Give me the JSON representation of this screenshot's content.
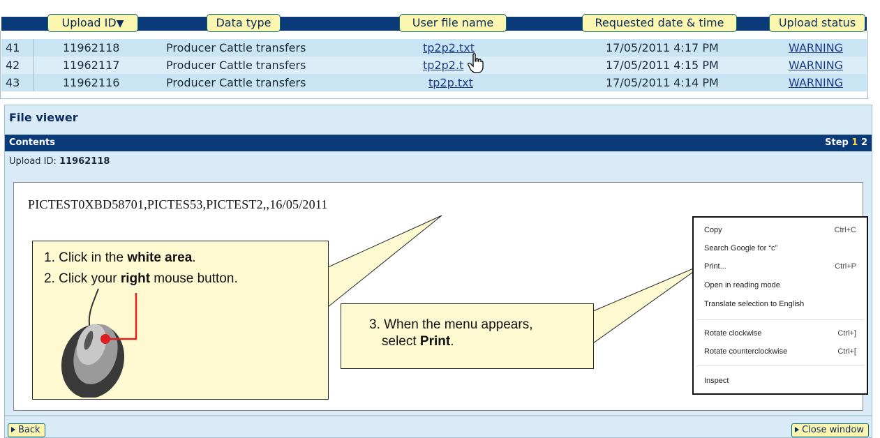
{
  "table": {
    "columns": [
      {
        "label": "Upload ID",
        "sort_icon": "▼"
      },
      {
        "label": "Data type"
      },
      {
        "label": "User file name"
      },
      {
        "label": "Requested date & time"
      },
      {
        "label": "Upload status"
      }
    ],
    "rows": [
      {
        "num": "41",
        "id": "11962118",
        "type": "Producer Cattle transfers",
        "file": "tp2p2.txt",
        "date": "17/05/2011 4:17 PM",
        "status": "WARNING"
      },
      {
        "num": "42",
        "id": "11962117",
        "type": "Producer Cattle transfers",
        "file": "tp2p2.t",
        "date": "17/05/2011 4:15 PM",
        "status": "WARNING"
      },
      {
        "num": "43",
        "id": "11962116",
        "type": "Producer Cattle transfers",
        "file": "tp2p.txt",
        "date": "17/05/2011 4:14 PM",
        "status": "WARNING"
      }
    ]
  },
  "viewer": {
    "title": "File viewer",
    "contents_label": "Contents",
    "step_label": "Step",
    "step_current": "1",
    "step_next": "2",
    "upload_id_label": "Upload ID:",
    "upload_id_value": "11962118",
    "file_text": "PICTEST0XBD58701,PICTES53,PICTEST2,,16/05/2011",
    "back_label": "Back",
    "close_label": "Close window"
  },
  "callouts": {
    "left_line1_pre": "1. Click in the ",
    "left_line1_bold": "white area",
    "left_line1_post": ".",
    "left_line2_pre": "2. Click your ",
    "left_line2_bold": "right",
    "left_line2_post": " mouse button.",
    "right_line1": "3. When the menu appears,",
    "right_line2_pre": "select ",
    "right_line2_bold": "Print",
    "right_line2_post": "."
  },
  "context_menu": {
    "items": [
      {
        "label": "Copy",
        "key": "Ctrl+C"
      },
      {
        "label": "Search Google for “c”",
        "key": ""
      },
      {
        "label": "Print...",
        "key": "Ctrl+P"
      },
      {
        "label": "Open in reading mode",
        "key": ""
      },
      {
        "label": "Translate selection to English",
        "key": ""
      },
      {
        "label": "Rotate clockwise",
        "key": "Ctrl+]"
      },
      {
        "label": "Rotate counterclockwise",
        "key": "Ctrl+["
      },
      {
        "label": "Inspect",
        "key": ""
      }
    ]
  },
  "colors": {
    "header_navy": "#0a3a78",
    "button_yellow": "#fdf6b0",
    "callout_bg": "#fdfad2",
    "row_blue": "#c9e4f2",
    "step_active": "#ffd24a",
    "red_pointer": "#e02020"
  }
}
